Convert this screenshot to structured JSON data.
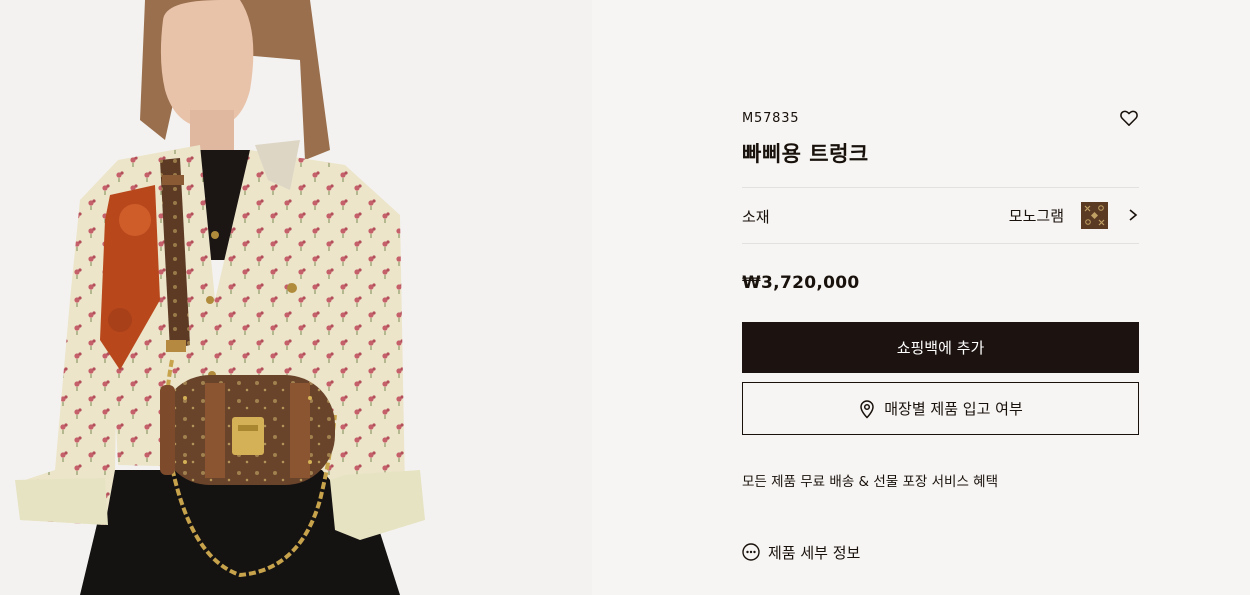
{
  "product": {
    "sku": "M57835",
    "name": "빠삐용 트렁크",
    "material_label": "소재",
    "material_value": "모노그램",
    "price": "₩3,720,000"
  },
  "actions": {
    "add_to_bag": "쇼핑백에 추가",
    "store_availability": "매장별 제품 입고 여부"
  },
  "benefits": {
    "text": "모든 제품 무료 배송 & 선물 포장 서비스 혜택"
  },
  "details": {
    "label": "제품 세부 정보"
  },
  "icons": {
    "wishlist": "heart-outline-icon",
    "material_swatch": "monogram-swatch",
    "material_arrow": "chevron-right-icon",
    "store": "location-pin-icon",
    "details": "ellipsis-circle-icon"
  },
  "colors": {
    "primary_button": "#1c1310",
    "text": "#19110b",
    "background": "#f6f5f3",
    "swatch": "#5b3a24"
  }
}
